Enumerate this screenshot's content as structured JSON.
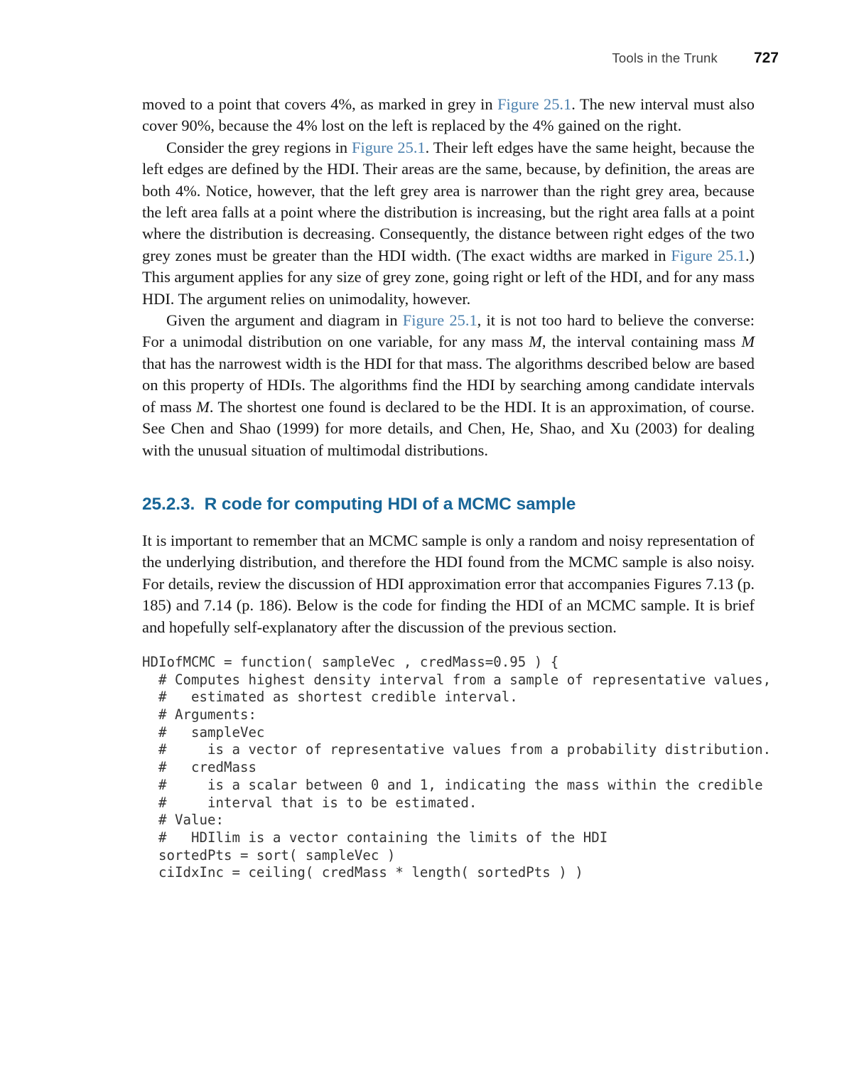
{
  "header": {
    "title": "Tools in the Trunk",
    "page_number": "727"
  },
  "colors": {
    "xref_blue": "#4a7fad",
    "heading_blue": "#176597",
    "body_text": "#161616",
    "code_text": "#333333",
    "page_background": "#ffffff"
  },
  "body": {
    "paragraph_1": {
      "seg_a": "moved to a point that covers 4%, as marked in grey in ",
      "xref_1": "Figure 25.1",
      "seg_b": ". The new interval must also cover 90%, because the 4% lost on the left is replaced by the 4% gained on the right."
    },
    "paragraph_2": {
      "seg_a": "Consider the grey regions in ",
      "xref_1": "Figure 25.1",
      "seg_b": ". Their left edges have the same height, because the left edges are defined by the HDI. Their areas are the same, because, by definition, the areas are both 4%. Notice, however, that the left grey area is narrower than the right grey area, because the left area falls at a point where the distribution is increasing, but the right area falls at a point where the distribution is decreasing. Consequently, the distance between right edges of the two grey zones must be greater than the HDI width. (The exact widths are marked in ",
      "xref_2": "Figure 25.1",
      "seg_c": ".) This argument applies for any size of grey zone, going right or left of the HDI, and for any mass HDI. The argument relies on unimodality, however."
    },
    "paragraph_3": {
      "seg_a": "Given the argument and diagram in ",
      "xref_1": "Figure 25.1",
      "seg_b": ", it is not too hard to believe the converse: For a unimodal distribution on one variable, for any mass ",
      "var_1": "M",
      "seg_c": ", the interval containing mass ",
      "var_2": "M",
      "seg_d": " that has the narrowest width is the HDI for that mass. The algorithms described below are based on this property of HDIs. The algorithms find the HDI by searching among candidate intervals of mass ",
      "var_3": "M",
      "seg_e": ". The shortest one found is declared to be the HDI. It is an approximation, of course. See Chen and Shao (1999) for more details, and Chen, He, Shao, and Xu (2003) for dealing with the unusual situation of multimodal distributions."
    },
    "section_heading": "25.2.3.  R code for computing HDI of a MCMC sample",
    "paragraph_4": {
      "text": "It is important to remember that an MCMC sample is only a random and noisy representation of the underlying distribution, and therefore the HDI found from the MCMC sample is also noisy. For details, review the discussion of HDI approximation error that accompanies Figures 7.13 (p. 185) and 7.14 (p. 186). Below is the code for finding the HDI of an MCMC sample. It is brief and hopefully self-explanatory after the discussion of the previous section."
    }
  },
  "code_block": {
    "language": "R",
    "lines": [
      "HDIofMCMC = function( sampleVec , credMass=0.95 ) {",
      "  # Computes highest density interval from a sample of representative values,",
      "  #   estimated as shortest credible interval.",
      "  # Arguments:",
      "  #   sampleVec",
      "  #     is a vector of representative values from a probability distribution.",
      "  #   credMass",
      "  #     is a scalar between 0 and 1, indicating the mass within the credible",
      "  #     interval that is to be estimated.",
      "  # Value:",
      "  #   HDIlim is a vector containing the limits of the HDI",
      "  sortedPts = sort( sampleVec )",
      "  ciIdxInc = ceiling( credMass * length( sortedPts ) )"
    ]
  }
}
